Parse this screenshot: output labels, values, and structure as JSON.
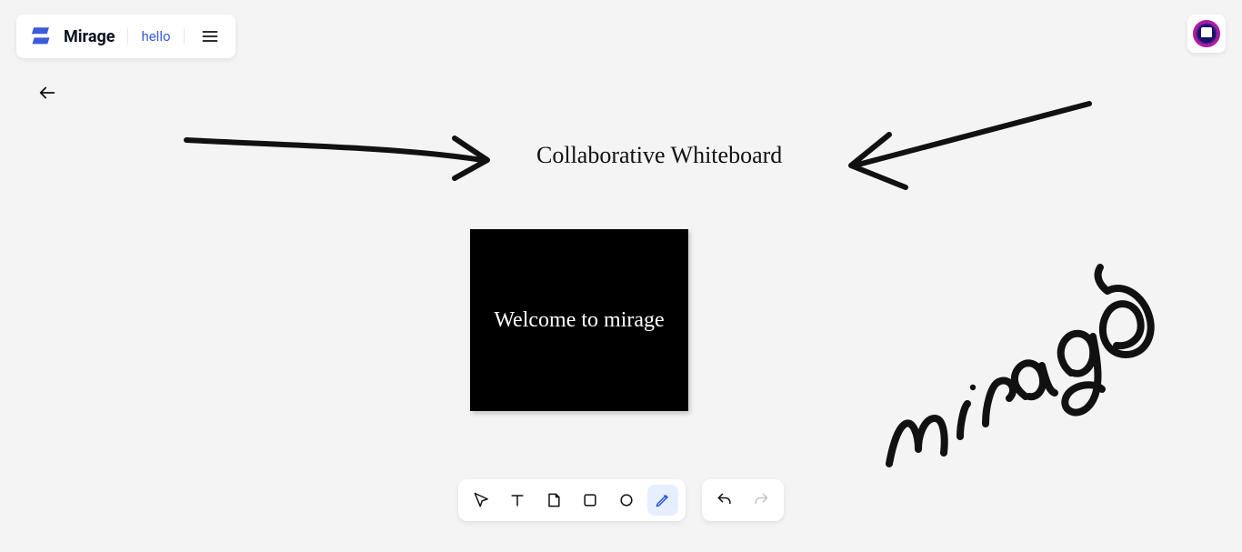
{
  "header": {
    "app_name": "Mirage",
    "document_name": "hello"
  },
  "icons": {
    "menu": "menu-icon",
    "back": "arrow-left-icon",
    "avatar": "avatar"
  },
  "canvas": {
    "title_text": "Collaborative Whiteboard",
    "welcome_text": "Welcome to mirage",
    "handwriting_text": "mirage"
  },
  "toolbar": {
    "tools": [
      {
        "name": "select",
        "label": "Select",
        "active": false
      },
      {
        "name": "text",
        "label": "Text",
        "active": false
      },
      {
        "name": "note",
        "label": "Note",
        "active": false
      },
      {
        "name": "rectangle",
        "label": "Rectangle",
        "active": false
      },
      {
        "name": "ellipse",
        "label": "Ellipse",
        "active": false
      },
      {
        "name": "pen",
        "label": "Pen",
        "active": true
      }
    ],
    "undo_label": "Undo",
    "redo_label": "Redo"
  }
}
